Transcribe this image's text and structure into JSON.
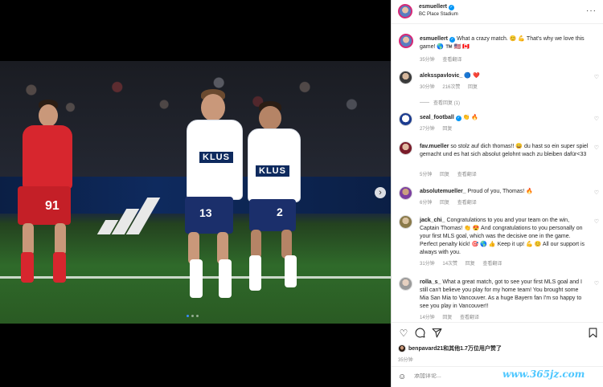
{
  "header": {
    "username": "esmuellert",
    "location": "BC Place Stadium"
  },
  "photo": {
    "sponsor_text": "KLUS",
    "jersey_numbers": [
      "91",
      "13",
      "2"
    ],
    "carousel": {
      "count": 3,
      "active": 1
    }
  },
  "caption": {
    "username": "esmuellert",
    "text": "What a crazy match. 😊 💪 That's why we love this game! 🌎 ™️ 🇺🇸 🇨🇦",
    "time": "35分钟",
    "translate": "查看翻译"
  },
  "comments": [
    {
      "username": "aleksspavlovic_",
      "text": "🔵 ❤️",
      "time": "30分钟",
      "likes": "216次赞",
      "reply": "回复",
      "replies": "查看回复 (1)"
    },
    {
      "username": "seal_football",
      "text": "👏 🔥",
      "time": "27分钟",
      "reply": "回复"
    },
    {
      "username": "fav.mueller",
      "text": "so stolz auf dich thomas!! 😄 du hast so ein super spiel gemacht und es hat sich absolut gelohnt wach zu bleiben dafür<33",
      "time": "5分钟",
      "reply": "回复",
      "translate": "查看翻译"
    },
    {
      "username": "absolutemueller_",
      "text": "Proud of you, Thomas! 🔥",
      "time": "6分钟",
      "reply": "回复",
      "translate": "查看翻译"
    },
    {
      "username": "jack_chi_",
      "text": "Congratulations to you and your team on the win, Captain Thomas! 👏 😍 And congratulations to you personally on your first MLS goal, which was the decisive one in the game. Perfect penalty kick! 🎯 🌎 👍 Keep it up! 💪 😊 All our support is always with you.",
      "time": "31分钟",
      "likes": "14次赞",
      "reply": "回复",
      "translate": "查看翻译"
    },
    {
      "username": "rolla_s_",
      "text": "What a great match, got to see your first MLS goal and I still can't believe you play for my home team! You brought some Mia San Mia to Vancouver. As a huge Bayern fan I'm so happy to see you play in Vancouver!!",
      "time": "14分钟",
      "reply": "回复",
      "translate": "查看翻译"
    }
  ],
  "likes": {
    "text": "benpavard21和其他1.7万位用户赞了"
  },
  "post_time": "35分钟",
  "comment_box": {
    "placeholder": "添加评论..."
  },
  "watermark": "www.365jz.com",
  "colors": {
    "verified": "#0095f6",
    "meta_gray": "#8e8e8e",
    "pitch": "#2f6a2a",
    "away_kit": "#d7262e",
    "home_kit": "#ffffff"
  }
}
